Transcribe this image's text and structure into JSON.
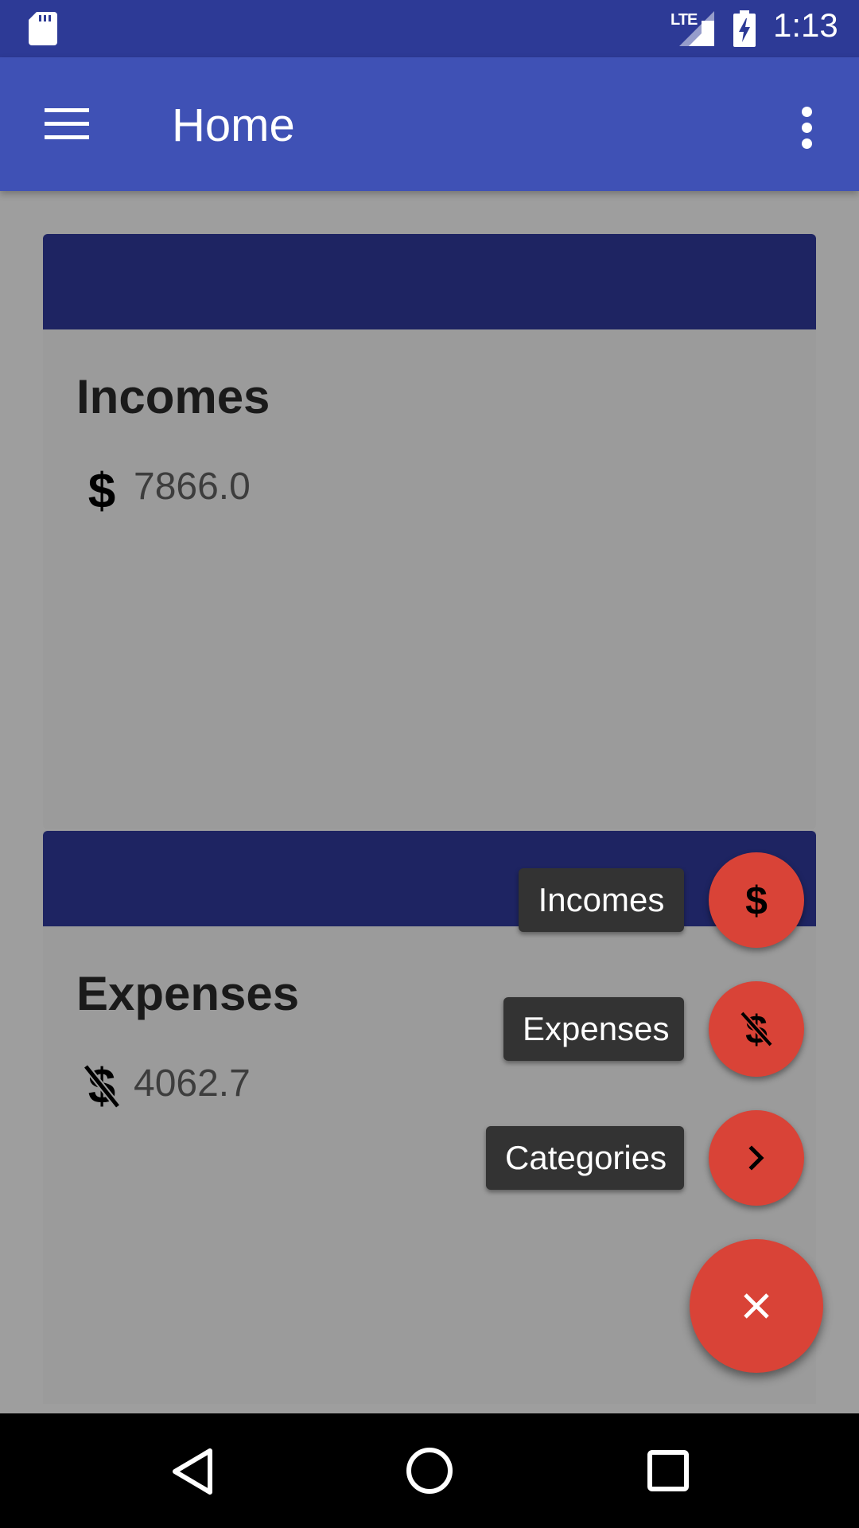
{
  "status_bar": {
    "network": "LTE",
    "time": "1:13",
    "icons": [
      "sd-card-icon",
      "signal-icon",
      "battery-charging-icon"
    ]
  },
  "app_bar": {
    "title": "Home",
    "icons": [
      "menu-icon",
      "overflow-menu-icon"
    ]
  },
  "cards": {
    "incomes": {
      "title": "Incomes",
      "amount": "7866.0",
      "icon": "dollar-icon"
    },
    "expenses": {
      "title": "Expenses",
      "amount": "4062.7",
      "icon": "dollar-off-icon"
    }
  },
  "fab_menu": {
    "items": [
      {
        "label": "Incomes",
        "icon": "dollar-icon"
      },
      {
        "label": "Expenses",
        "icon": "dollar-off-icon"
      },
      {
        "label": "Categories",
        "icon": "chevron-right-icon"
      }
    ],
    "main_icon": "close-icon"
  },
  "nav_bar": {
    "icons": [
      "back-icon",
      "home-icon",
      "recents-icon"
    ]
  },
  "colors": {
    "status_bar": "#2d3a96",
    "app_bar": "#3f51b5",
    "card_header": "#1e2462",
    "fab": "#d94337",
    "scrim_background": "#9e9e9e",
    "fab_label": "#333333"
  }
}
